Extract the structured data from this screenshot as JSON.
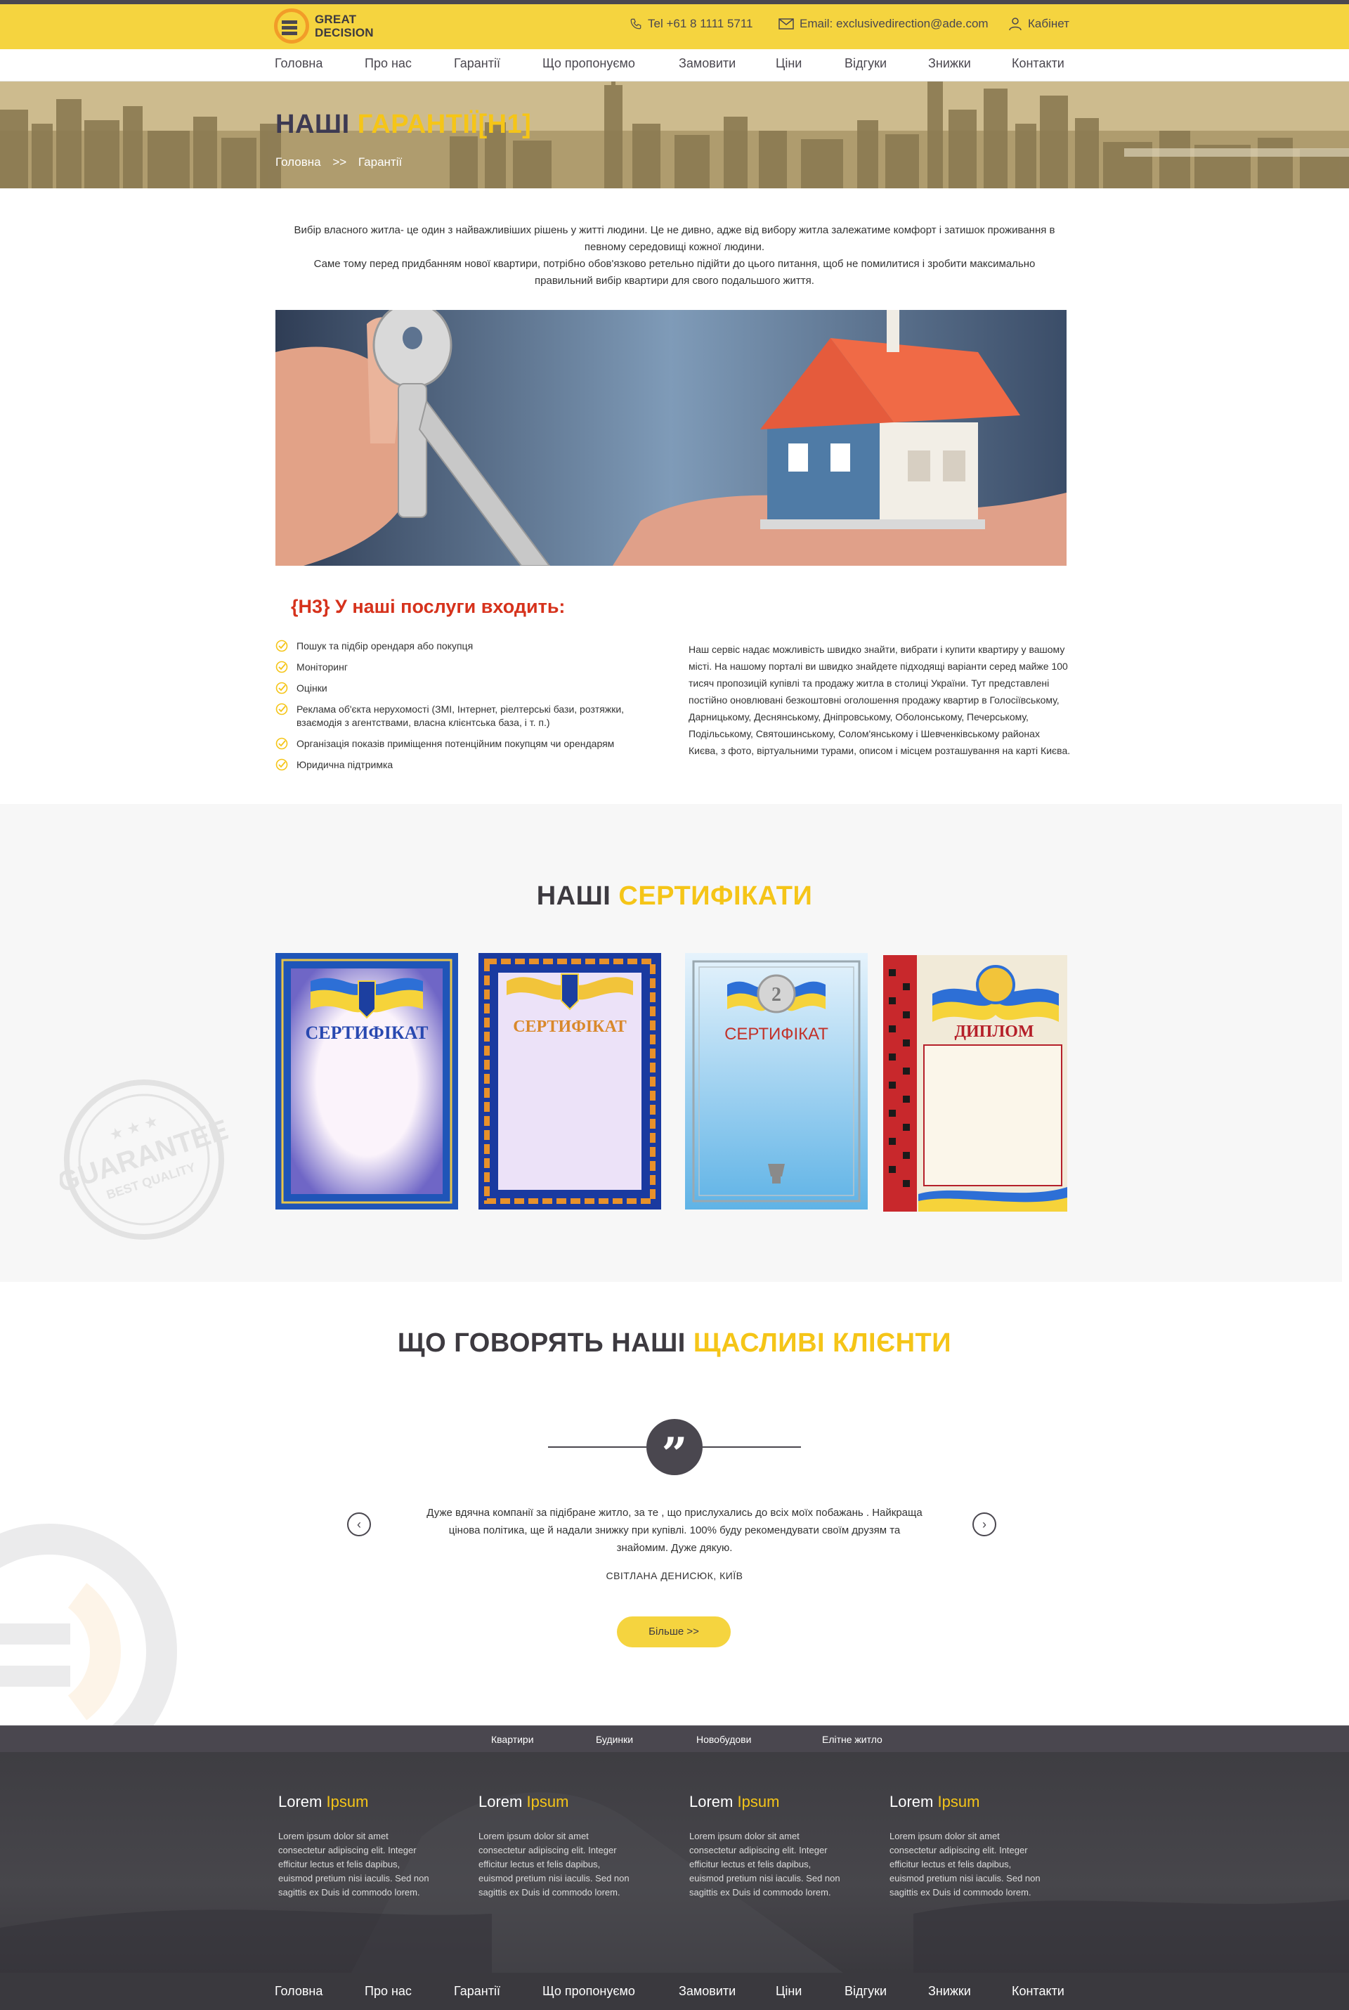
{
  "header": {
    "logo_line1": "GREAT",
    "logo_line2": "DECISION",
    "phone": "Tel +61 8 1111 5711",
    "email": "Email: exclusivedirection@ade.com",
    "cabinet": "Кабінет"
  },
  "nav": [
    "Головна",
    "Про нас",
    "Гарантії",
    "Що пропонуємо",
    "Замовити",
    "Ціни",
    "Відгуки",
    "Знижки",
    "Контакти"
  ],
  "hero": {
    "title_dark": "НАШІ",
    "title_yellow": "ГАРАНТІЇ[H1]",
    "crumb_home": "Головна",
    "crumb_sep": ">>",
    "crumb_current": "Гарантії"
  },
  "intro": {
    "p1": "Вибір власного житла- це один з найважливіших рішень у житті людини. Це не дивно, адже від вибору житла залежатиме комфорт і затишок проживання в певному середовищі кожної людини.",
    "p2": "Саме тому перед придбанням нової квартири, потрібно обов'язково ретельно підійти до цього питання, щоб не помилитися і зробити максимально правильний вибір квартири для свого подальшого життя."
  },
  "services": {
    "title": "{H3} У наші послуги входить:",
    "items": [
      "Пошук та підбір орендаря або покупця",
      "Моніторинг",
      "Оцінки",
      "Реклама об'єкта нерухомості (ЗМІ, Інтернет, ріелтерські бази, розтяжки, взаємодія з агентствами, власна клієнтська база, і т. п.)",
      "Організація показів приміщення потенційним покупцям чи орендарям",
      "Юридична підтримка"
    ],
    "text": "Наш сервіс надає можливість швидко знайти, вибрати і купити квартиру у вашому місті. На нашому порталі ви швидко знайдете підходящі варіанти серед майже 100 тисяч пропозицій купівлі та продажу житла в столиці України. Тут представлені постійно оновлювані безкоштовні оголошення продажу квартир в Голосіївському, Дарницькому, Деснянському, Дніпровському, Оболонському, Печерському, Подільському, Святошинському, Солом'янському і Шевченківському районах Києва, з фото, віртуальними турами, описом і місцем розташування на карті Києва."
  },
  "certificates": {
    "title_dark": "НАШІ",
    "title_yellow": "СЕРТИФІКАТИ",
    "stamp_line1": "GUARANTEE",
    "stamp_line2": "BEST QUALITY",
    "items": [
      "СЕРТИФІКАТ",
      "СЕРТИФІКАТ",
      "СЕРТИФІКАТ",
      "ДИПЛОМ"
    ],
    "medal_number": "2"
  },
  "testimonials": {
    "title_dark": "ЩО ГОВОРЯТЬ НАШІ",
    "title_yellow": "ЩАСЛИВІ КЛІЄНТИ",
    "quote_mark": "”",
    "text": "Дуже вдячна компанії за підібране житло, за те , що прислухались до всіх моїх побажань . Найкраща цінова політика, ще й надали  знижку при купівлі. 100% буду рекомендувати своїм друзям та знайомим. Дуже дякую.",
    "author": "СВІТЛАНА ДЕНИСЮК, КИЇВ",
    "button": "Більше >>",
    "prev": "‹",
    "next": "›"
  },
  "footer": {
    "top_links": [
      "Квартири",
      "Будинки",
      "Новобудови",
      "Елітне житло"
    ],
    "columns": [
      {
        "title_white": "Lorem",
        "title_yellow": "Ipsum",
        "text": "Lorem ipsum dolor sit amet consectetur adipiscing elit. Integer efficitur lectus et felis dapibus, euismod pretium nisi iaculis. Sed non sagittis ex Duis id commodo lorem."
      },
      {
        "title_white": "Lorem",
        "title_yellow": "Ipsum",
        "text": "Lorem ipsum dolor sit amet consectetur adipiscing elit. Integer efficitur lectus et felis dapibus, euismod pretium nisi iaculis. Sed non sagittis ex Duis id commodo lorem."
      },
      {
        "title_white": "Lorem",
        "title_yellow": "Ipsum",
        "text": "Lorem ipsum dolor sit amet consectetur adipiscing elit. Integer efficitur lectus et felis dapibus, euismod pretium nisi iaculis. Sed non sagittis ex Duis id commodo lorem."
      },
      {
        "title_white": "Lorem",
        "title_yellow": "Ipsum",
        "text": "Lorem ipsum dolor sit amet consectetur adipiscing elit. Integer efficitur lectus et felis dapibus, euismod pretium nisi iaculis. Sed non sagittis ex Duis id commodo lorem."
      }
    ]
  },
  "colors": {
    "brand_yellow": "#f5d43f",
    "accent_yellow": "#f5c518",
    "dark": "#4a474f",
    "heading_red": "#d6321c",
    "logo_orange": "#f29c28"
  },
  "icons": [
    "phone-icon",
    "mail-icon",
    "user-icon",
    "check-icon",
    "quote-icon",
    "arrow-left-icon",
    "arrow-right-icon"
  ]
}
